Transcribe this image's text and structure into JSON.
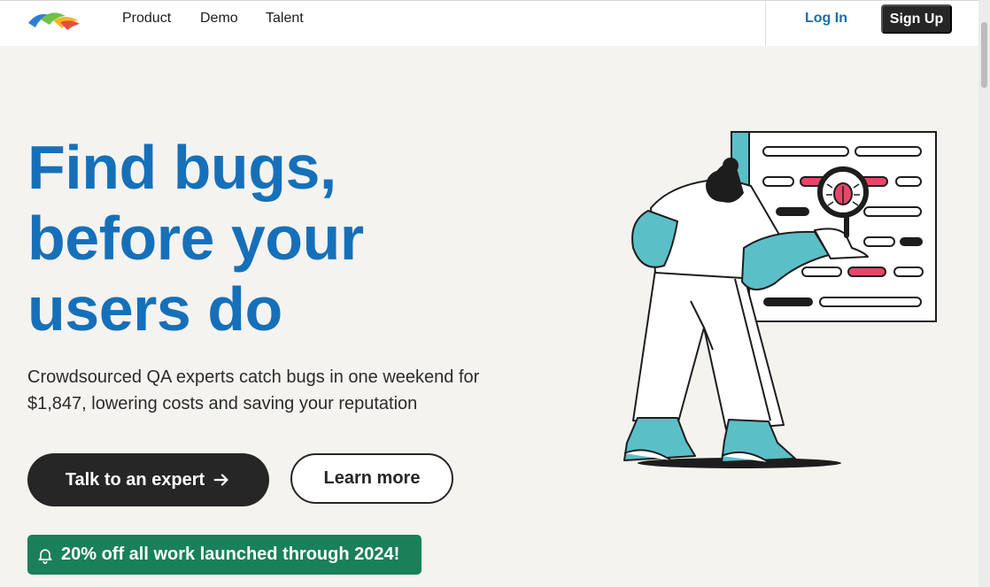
{
  "nav": {
    "items": [
      {
        "label": "Product"
      },
      {
        "label": "Demo"
      },
      {
        "label": "Talent"
      }
    ],
    "login_label": "Log In",
    "signup_label": "Sign Up"
  },
  "hero": {
    "title_lines": [
      "Find bugs,",
      "before your",
      "users do"
    ],
    "subtitle": "Crowdsourced QA experts catch bugs in one weekend for $1,847, lowering costs and saving your reputation",
    "primary_cta": "Talk to an expert",
    "secondary_cta": "Learn more",
    "promo": "20% off all work launched through 2024!"
  },
  "icons": {
    "logo": "brand-logo",
    "cta_arrow": "arrow-right-icon",
    "promo": "bell-icon",
    "illustration_bug": "bug-icon",
    "illustration_magnifier": "magnifier-icon"
  },
  "colors": {
    "accent": "#1670b9",
    "primary_button": "#262626",
    "promo_bg": "#19805a",
    "illustration_teal": "#5bbfc8",
    "illustration_pink": "#e8456a",
    "page_bg": "#f4f3f0"
  }
}
